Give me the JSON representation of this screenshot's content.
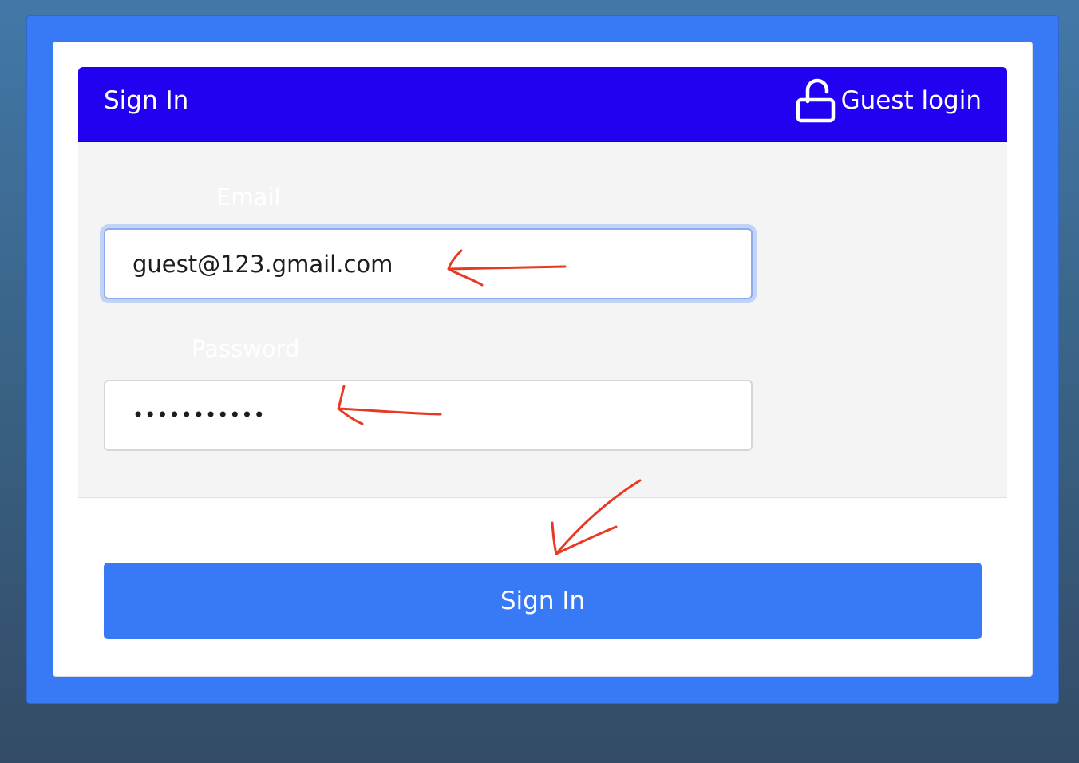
{
  "header": {
    "title": "Sign In",
    "guest_login_label": "Guest login",
    "guest_login_icon": "unlock-icon"
  },
  "form": {
    "email": {
      "label": "Email",
      "value": "guest@123.gmail.com"
    },
    "password": {
      "label": "Password",
      "value": "•••••••••••"
    }
  },
  "actions": {
    "sign_in_label": "Sign In"
  },
  "colors": {
    "header_background": "#2200f0",
    "accent": "#387af6",
    "annotation_arrows": "#e63a24"
  }
}
